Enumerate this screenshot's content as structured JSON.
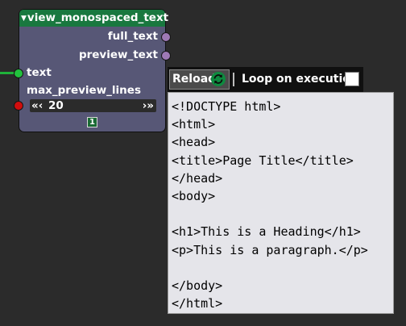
{
  "node": {
    "title": "view_monospaced_text",
    "outputs": [
      "full_text",
      "preview_text"
    ],
    "inputs": [
      "text",
      "max_preview_lines"
    ],
    "max_preview_lines_value": "20",
    "left_arrows": "«‹",
    "right_arrows": "›»",
    "badge": "1"
  },
  "toolbar": {
    "reload_label": "Reload",
    "loop_label": "Loop on execution",
    "loop_checked": false
  },
  "text_view": {
    "lines": [
      "<!DOCTYPE html>",
      "<html>",
      "<head>",
      "<title>Page Title</title>",
      "</head>",
      "<body>",
      "",
      "<h1>This is a Heading</h1>",
      "<p>This is a paragraph.</p>",
      "",
      "</body>",
      "</html>"
    ]
  },
  "colors": {
    "node_header": "#19783f",
    "node_body": "#575776",
    "output_socket": "#9e79b5",
    "text_socket": "#22c23d",
    "int_socket": "#d10d0d",
    "text_panel_bg": "#e5e5ea"
  }
}
